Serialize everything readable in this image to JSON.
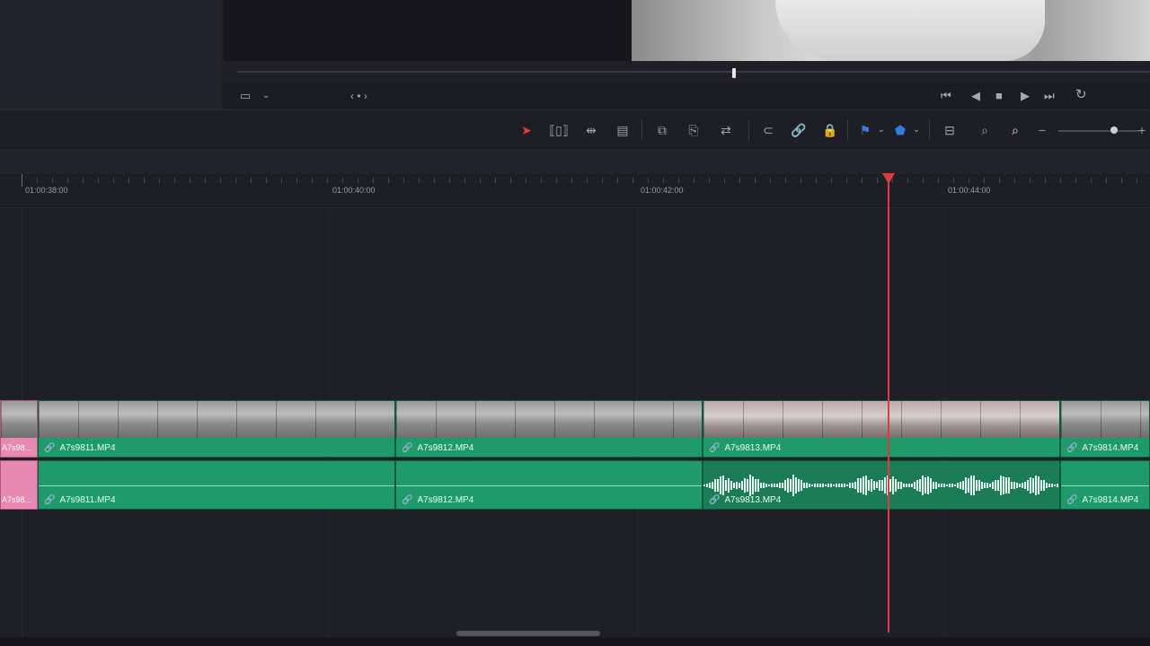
{
  "viewer": {
    "nav_label": "‹ • ›"
  },
  "timeline": {
    "timecodes": [
      "01:00:38:00",
      "01:00:40:00",
      "01:00:42:00",
      "01:00:44:00"
    ],
    "video_clips": [
      {
        "name": "A7s98...",
        "style": "pink"
      },
      {
        "name": "A7s9811.MP4",
        "style": "normal"
      },
      {
        "name": "A7s9812.MP4",
        "style": "normal"
      },
      {
        "name": "A7s9813.MP4",
        "style": "warm"
      },
      {
        "name": "A7s9814.MP4",
        "style": "normal"
      }
    ],
    "audio_clips": [
      {
        "name": "A7s98...",
        "style": "pink"
      },
      {
        "name": "A7s9811.MP4",
        "style": "normal"
      },
      {
        "name": "A7s9812.MP4",
        "style": "normal"
      },
      {
        "name": "A7s9813.MP4",
        "style": "waveform"
      },
      {
        "name": "A7s9814.MP4",
        "style": "normal"
      }
    ]
  },
  "colors": {
    "clip_green": "#1f9a6a",
    "playhead_red": "#e23a3a",
    "flag_blue": "#2f7de1",
    "pink_clip": "#e889b3"
  },
  "icons": {
    "zoom_minus": "−",
    "zoom_plus": "+"
  }
}
